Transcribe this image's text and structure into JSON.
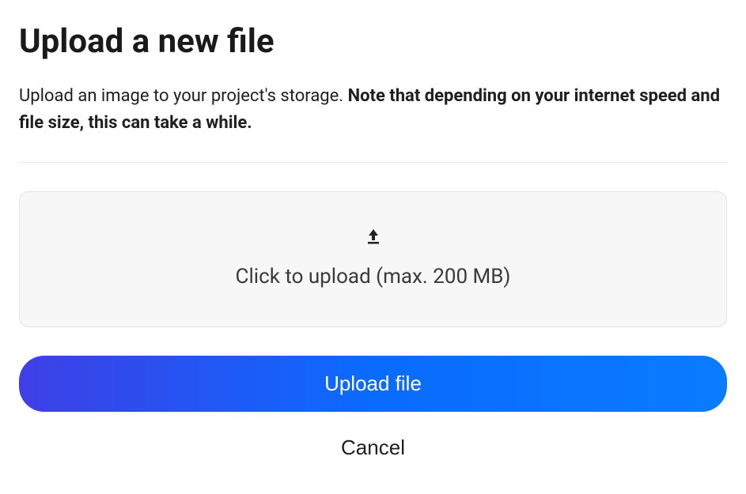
{
  "dialog": {
    "title": "Upload a new file",
    "description_normal": "Upload an image to your project's storage. ",
    "description_bold": "Note that depending on your internet speed and file size, this can take a while."
  },
  "dropzone": {
    "label": "Click to upload (max. 200 MB)",
    "max_size_mb": 200
  },
  "actions": {
    "upload_label": "Upload file",
    "cancel_label": "Cancel"
  }
}
